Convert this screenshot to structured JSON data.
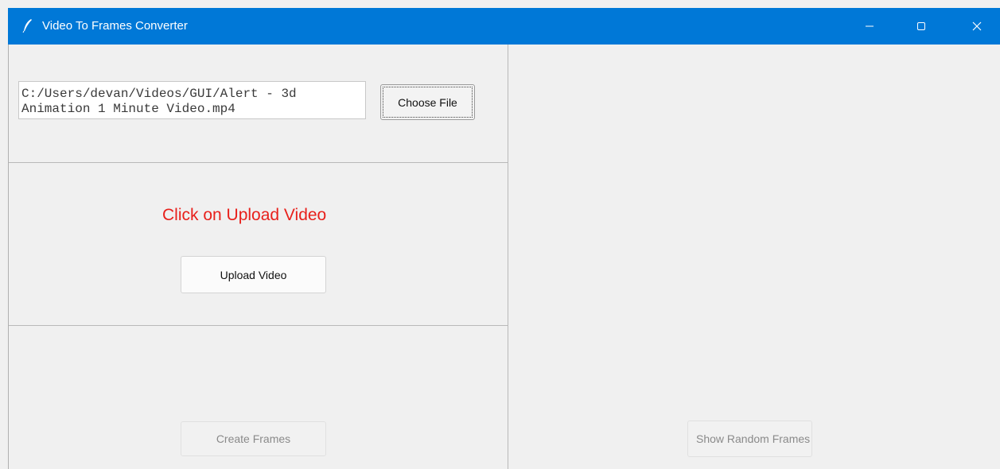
{
  "window": {
    "title": "Video To Frames Converter",
    "titlebar_color": "#0078d7",
    "icons": {
      "app": "feather-icon",
      "minimize": "minimize-icon",
      "maximize": "maximize-icon",
      "close": "close-icon"
    }
  },
  "file_section": {
    "path_value": "C:/Users/devan/Videos/GUI/Alert - 3d Animation 1 Minute Video.mp4",
    "choose_label": "Choose File"
  },
  "upload_section": {
    "status_text": "Click on Upload Video",
    "status_color": "#e8201b",
    "upload_label": "Upload Video"
  },
  "frames_section": {
    "create_label": "Create Frames"
  },
  "preview_panel": {
    "random_label": "Show Random Frames"
  }
}
